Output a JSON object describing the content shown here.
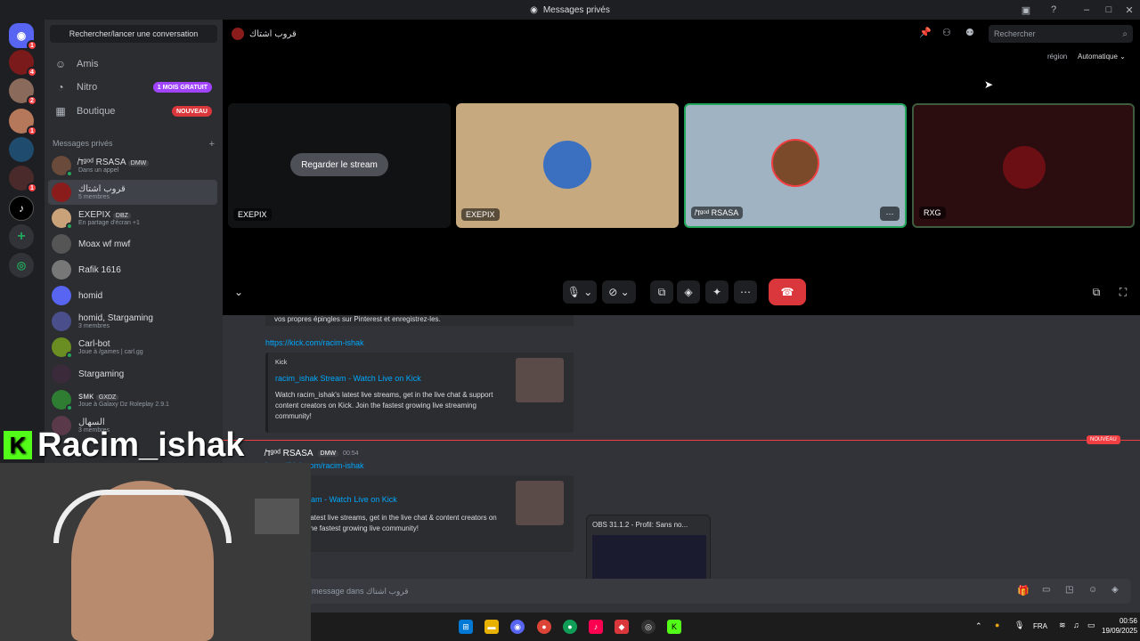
{
  "window": {
    "title": "Messages privés"
  },
  "dm_sidebar": {
    "search": "Rechercher/lancer une conversation",
    "nav": [
      {
        "label": "Amis",
        "icon": "friends-icon"
      },
      {
        "label": "Nitro",
        "icon": "nitro-icon",
        "pill": "1 MOIS GRATUIT"
      },
      {
        "label": "Boutique",
        "icon": "shop-icon",
        "pill": "NOUVEAU"
      }
    ],
    "header": "Messages privés",
    "dms": [
      {
        "name": "ד̸ᵍᵒᵈ RSASA",
        "tag": "DMW",
        "sub": "Dans un appel"
      },
      {
        "name": "قروب اشتاك",
        "sub": "5 membres"
      },
      {
        "name": "EXEPIX",
        "tag": "DBZ",
        "sub": "En partage d'écran +1"
      },
      {
        "name": "Moax wf mwf",
        "sub": ""
      },
      {
        "name": "Rafik 1616",
        "sub": ""
      },
      {
        "name": "homid",
        "sub": ""
      },
      {
        "name": "homid, Stargaming",
        "sub": "3 membres"
      },
      {
        "name": "Carl-bot",
        "sub": "Joue à /games | carl.gg"
      },
      {
        "name": "Stargaming",
        "sub": ""
      },
      {
        "name": "ꜱᴍᴋ",
        "tag": "GXDZ",
        "sub": "Joue à Galaxy Dz Roleplay 2.9.1"
      },
      {
        "name": "السهال",
        "sub": "3 membres"
      }
    ]
  },
  "call": {
    "title": "قروب اشتاك",
    "search_placeholder": "Rechercher",
    "region_label": "région",
    "region_value": "Automatique",
    "watch_button": "Regarder le stream",
    "tiles": [
      {
        "label": "EXEPIX",
        "bg": "#000000"
      },
      {
        "label": "EXEPIX",
        "bg": "#c6a97f"
      },
      {
        "label": "ד̸ᵍᵒᵈ RSASA",
        "bg": "#9fb3c2"
      },
      {
        "label": "RXG",
        "bg": "#2b0d10"
      }
    ]
  },
  "chat": {
    "top_text": "vos propres épingles sur Pinterest et enregistrez-les.",
    "link": "https://kick.com/racim-ishak",
    "embed_provider": "Kick",
    "embed_title": "racim_ishak Stream - Watch Live on Kick",
    "embed_desc": "Watch racim_ishak's latest live streams, get in the live chat & support content creators on Kick. Join the fastest growing live streaming community!",
    "new_label": "NOUVEAU",
    "msg_author": "ד̸ᵍᵒᵈ RSASA",
    "msg_tag": "DMW",
    "msg_time": "00:54",
    "msg_link": "https://kick.com/racim-ishak",
    "embed2_title": "ishak Stream - Watch Live on Kick",
    "embed2_desc": "m_ishak's latest live streams, get in the live chat & content creators on Kick. Join the fastest growing live community!",
    "input_placeholder": "message dans قروب اشتاك"
  },
  "obs_preview": {
    "title": "OBS 31.1.2 - Profil: Sans no..."
  },
  "overlay": {
    "streamer_name": "Racim_ishak"
  },
  "taskbar": {
    "lang": "FRA",
    "time": "00:56",
    "date": "19/09/2025"
  },
  "colors": {
    "blurple": "#5865f2",
    "red": "#da373c",
    "green": "#23a55a",
    "pink": "#ff73fa"
  }
}
